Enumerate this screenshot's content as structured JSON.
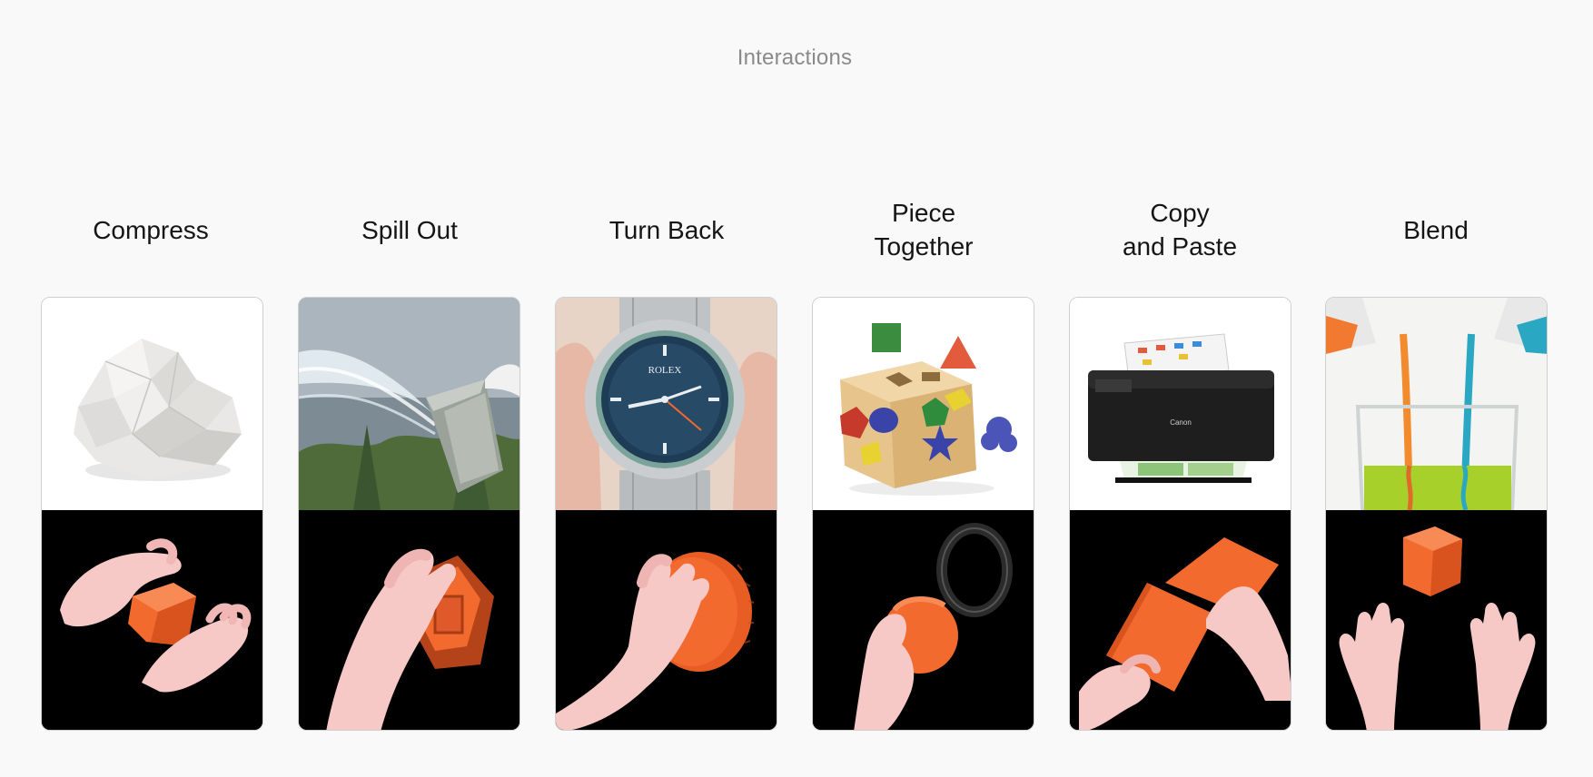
{
  "header": {
    "title": "Interactions"
  },
  "columns": [
    {
      "title_line1": "Compress",
      "title_line2": "",
      "object": "crumpled-paper",
      "gesture": "hands-squeezing-orange-cube"
    },
    {
      "title_line1": "Spill Out",
      "title_line2": "",
      "object": "water-pouring-from-bucket",
      "gesture": "hand-tipping-orange-container"
    },
    {
      "title_line1": "Turn Back",
      "title_line2": "",
      "object": "wristwatch",
      "gesture": "hand-turning-orange-dial"
    },
    {
      "title_line1": "Piece",
      "title_line2": "Together",
      "object": "shape-sorter-cube",
      "gesture": "hand-fitting-ball-into-ring"
    },
    {
      "title_line1": "Copy",
      "title_line2": "and Paste",
      "object": "printer",
      "gesture": "hands-placing-orange-sheets"
    },
    {
      "title_line1": "Blend",
      "title_line2": "",
      "object": "liquids-pouring-into-beaker",
      "gesture": "hands-below-floating-cube"
    }
  ],
  "watch": {
    "brand": "ROLEX"
  },
  "printer": {
    "brand": "Canon"
  },
  "colors": {
    "page_bg": "#f9f9f9",
    "accent_orange": "#f26a2e",
    "skin": "#f7c9c6",
    "title_gray": "#8a8a8a"
  }
}
